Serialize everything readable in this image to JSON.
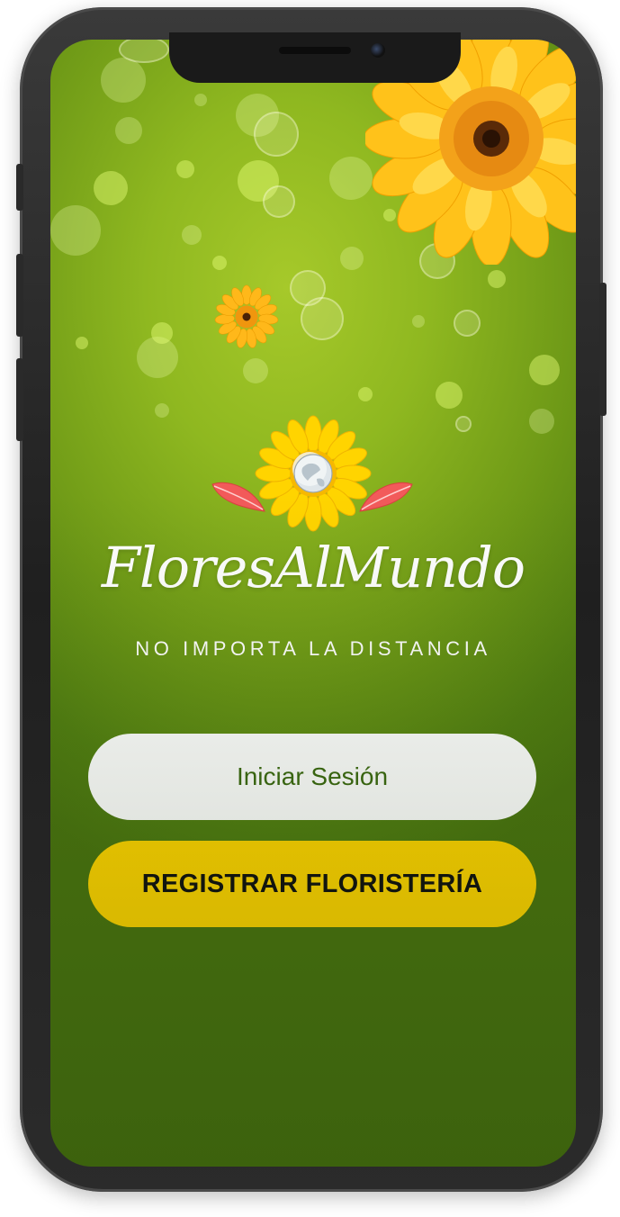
{
  "app": {
    "brand_name": "FloresAlMundo",
    "tagline": "NO IMPORTA LA DISTANCIA"
  },
  "actions": {
    "login_label": "Iniciar Sesión",
    "register_label": "REGISTRAR FLORISTERÍA"
  },
  "colors": {
    "background_green": "#6f9a17",
    "register_button": "#ffd400",
    "login_button": "#ffffff",
    "login_text": "#3c6a12",
    "flower_yellow": "#ffcc1a",
    "leaf_pink": "#f25a5a"
  },
  "icons": {
    "logo": "sunflower-globe-icon",
    "decor_large": "gerbera-flower-icon",
    "decor_small": "gerbera-flower-icon"
  }
}
